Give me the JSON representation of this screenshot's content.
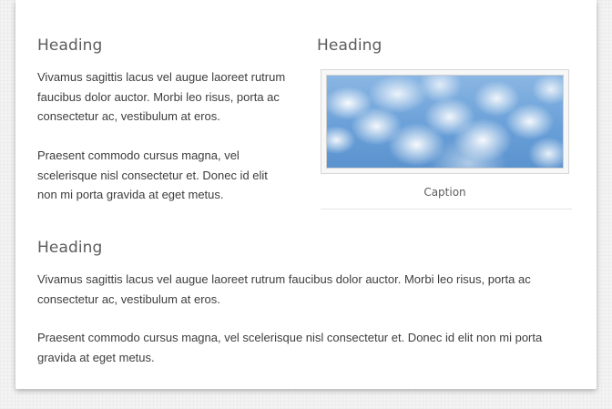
{
  "left_column": {
    "heading": "Heading",
    "paragraphs": [
      "Vivamus sagittis lacus vel augue laoreet rutrum faucibus dolor auctor. Morbi leo risus, porta ac consectetur ac, vestibulum at eros.",
      "Praesent commodo cursus magna, vel scelerisque nisl consectetur et. Donec id elit non mi porta gravida at eget metus."
    ]
  },
  "right_column": {
    "heading": "Heading",
    "image_subject": "clouds-sky-image",
    "caption": "Caption"
  },
  "bottom_section": {
    "heading": "Heading",
    "paragraphs": [
      "Vivamus sagittis lacus vel augue laoreet rutrum faucibus dolor auctor. Morbi leo risus, porta ac consectetur ac, vestibulum at eros.",
      "Praesent commodo cursus magna, vel scelerisque nisl consectetur et. Donec id elit non mi porta gravida at eget metus."
    ]
  }
}
